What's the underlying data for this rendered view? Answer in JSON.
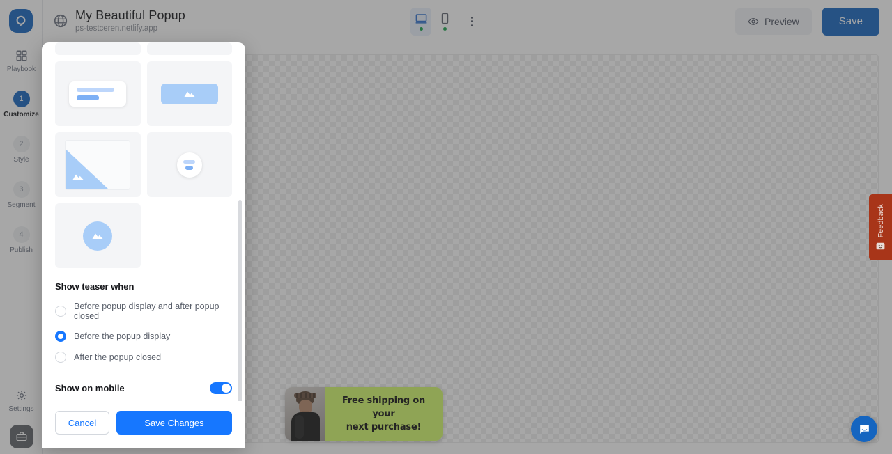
{
  "topbar": {
    "logo_icon": "popupsmart-logo-icon",
    "globe_icon": "globe-icon",
    "project_title": "My Beautiful Popup",
    "project_domain": "ps-testceren.netlify.app",
    "devices": [
      {
        "name": "desktop",
        "icon": "desktop-icon",
        "active": true,
        "status": "online"
      },
      {
        "name": "mobile",
        "icon": "mobile-icon",
        "active": false,
        "status": "online"
      }
    ],
    "more_icon": "kebab-menu-icon",
    "preview_label": "Preview",
    "preview_icon": "eye-icon",
    "save_label": "Save"
  },
  "sidebar": {
    "playbook": {
      "label": "Playbook",
      "icon": "grid-icon"
    },
    "steps": [
      {
        "number": "1",
        "label": "Customize",
        "active": true
      },
      {
        "number": "2",
        "label": "Style",
        "active": false
      },
      {
        "number": "3",
        "label": "Segment",
        "active": false
      },
      {
        "number": "4",
        "label": "Publish",
        "active": false
      }
    ],
    "settings": {
      "label": "Settings",
      "icon": "gear-icon"
    },
    "avatar_icon": "briefcase-avatar-icon"
  },
  "panel": {
    "templates": [
      {
        "name": "template-clipped-left",
        "kind": "clipped"
      },
      {
        "name": "template-clipped-right",
        "kind": "clipped"
      },
      {
        "name": "template-card-bars",
        "kind": "card"
      },
      {
        "name": "template-banner-image",
        "kind": "banner"
      },
      {
        "name": "template-corner-triangle",
        "kind": "frame"
      },
      {
        "name": "template-circle-badge",
        "kind": "circle"
      },
      {
        "name": "template-big-circle-image",
        "kind": "bigcircle"
      }
    ],
    "section_title": "Show teaser when",
    "radio_options": [
      {
        "label": "Before popup display and after popup closed",
        "selected": false
      },
      {
        "label": "Before the popup display",
        "selected": true
      },
      {
        "label": "After the popup closed",
        "selected": false
      }
    ],
    "mobile_label": "Show on mobile",
    "mobile_enabled": "on",
    "cancel_label": "Cancel",
    "save_changes_label": "Save Changes"
  },
  "canvas": {
    "teaser": {
      "text_line_1": "Free shipping on your",
      "text_line_2": "next purchase!",
      "background_color": "#d4f96a",
      "image_name": "teaser-model-photo"
    }
  },
  "widgets": {
    "feedback_label": "Feedback",
    "feedback_icon": "smiley-icon",
    "feedback_color": "#a83519",
    "chat_icon": "chat-bubble-icon",
    "chat_color": "#1565c0"
  },
  "colors": {
    "brand_blue": "#1565c0",
    "accent_blue": "#1677ff",
    "light_blue": "#a8cdf8",
    "status_green": "#16a34a"
  }
}
